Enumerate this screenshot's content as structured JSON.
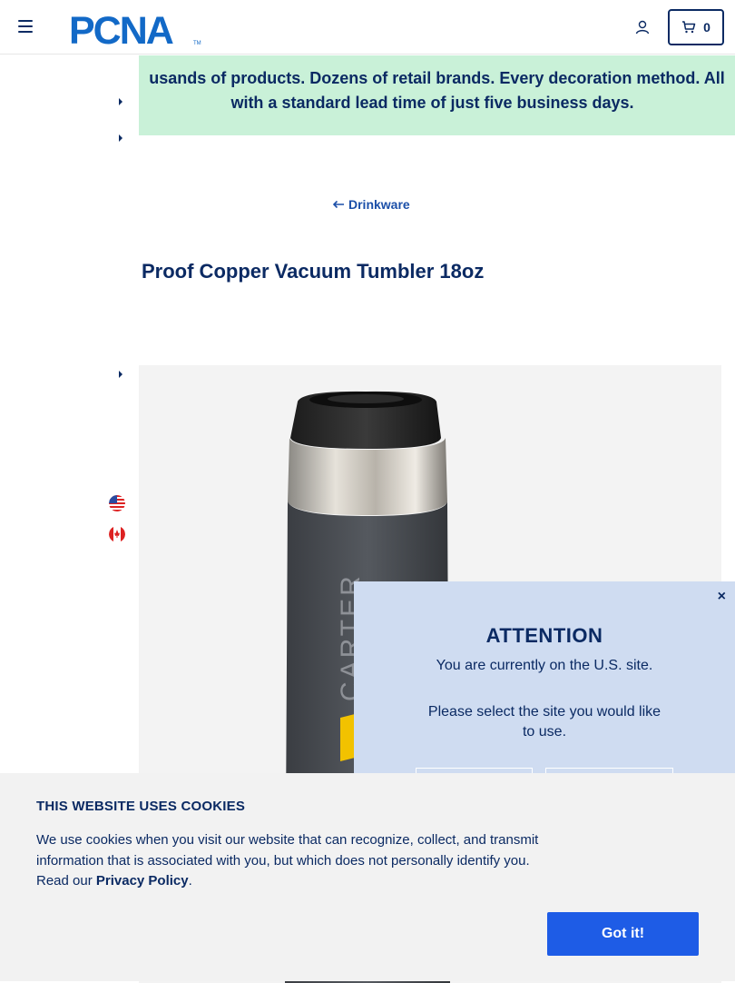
{
  "header": {
    "logo_text": "PCNA",
    "cart_count": "0"
  },
  "banner": {
    "line1": "usands of products. Dozens of retail brands. Every decoration method. All",
    "line2": "with a standard lead time of just five business days."
  },
  "breadcrumb": {
    "label": "Drinkware"
  },
  "product": {
    "title": "Proof Copper Vacuum Tumbler 18oz",
    "imprint_text": "CARTER"
  },
  "locale_options": [
    {
      "icon": "us-flag-icon"
    },
    {
      "icon": "canada-flag-icon"
    }
  ],
  "modal": {
    "close": "×",
    "title": "ATTENTION",
    "line1": "You are currently on the U.S. site.",
    "line2": "Please select the site you would like to use."
  },
  "cookie_banner": {
    "title": "THIS WEBSITE USES COOKIES",
    "body": "We use cookies when you visit our website that can recognize, collect, and transmit information that is associated with you, but which does not personally identify you. Read our ",
    "link": "Privacy Policy",
    "tail": ".",
    "button": "Got it!"
  },
  "colors": {
    "navy": "#0b2a63",
    "banner_green": "#c9f1d8",
    "modal_blue": "#cfdcf1",
    "button_blue": "#1e5ce6"
  }
}
